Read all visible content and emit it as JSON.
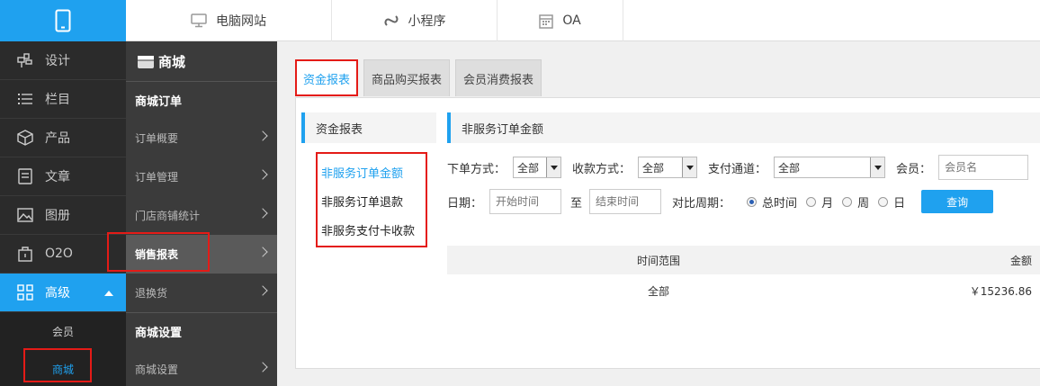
{
  "topbar": {
    "tabs": [
      {
        "label": "电脑网站",
        "icon": "monitor-icon"
      },
      {
        "label": "小程序",
        "icon": "mini-program-icon"
      },
      {
        "label": "OA",
        "icon": "calendar-icon"
      }
    ]
  },
  "leftnav": {
    "items": [
      {
        "label": "设计",
        "icon": "design-icon"
      },
      {
        "label": "栏目",
        "icon": "list-icon"
      },
      {
        "label": "产品",
        "icon": "box-icon"
      },
      {
        "label": "文章",
        "icon": "document-icon"
      },
      {
        "label": "图册",
        "icon": "image-icon"
      },
      {
        "label": "O2O",
        "icon": "o2o-icon"
      },
      {
        "label": "高级",
        "icon": "grid-icon"
      }
    ],
    "sub_items": [
      "会员",
      "商城"
    ]
  },
  "secnav": {
    "title": "商城",
    "group1": "商城订单",
    "items": [
      "订单概要",
      "订单管理",
      "门店商铺统计",
      "销售报表",
      "退换货"
    ],
    "group2": "商城设置",
    "items2": [
      "商城设置"
    ]
  },
  "tabs": [
    "资金报表",
    "商品购买报表",
    "会员消费报表"
  ],
  "subnav": {
    "title": "资金报表",
    "links": [
      "非服务订单金额",
      "非服务订单退款",
      "非服务支付卡收款"
    ]
  },
  "content": {
    "title": "非服务订单金额",
    "filters": {
      "order_type_label": "下单方式：",
      "order_type_value": "全部",
      "pay_type_label": "收款方式：",
      "pay_type_value": "全部",
      "pay_channel_label": "支付通道：",
      "pay_channel_value": "全部",
      "member_label": "会员：",
      "member_placeholder": "会员名",
      "date_label": "日期：",
      "start_placeholder": "开始时间",
      "to_label": "至",
      "end_placeholder": "结束时间",
      "period_label": "对比周期：",
      "period_options": [
        "总时间",
        "月",
        "周",
        "日"
      ],
      "period_selected": "总时间",
      "query_label": "查询"
    },
    "table": {
      "headers": [
        "时间范围",
        "金额"
      ],
      "rows": [
        [
          "全部",
          "￥15236.86"
        ]
      ]
    }
  },
  "colors": {
    "accent": "#1fa1ef",
    "highlight": "#e41b17"
  }
}
